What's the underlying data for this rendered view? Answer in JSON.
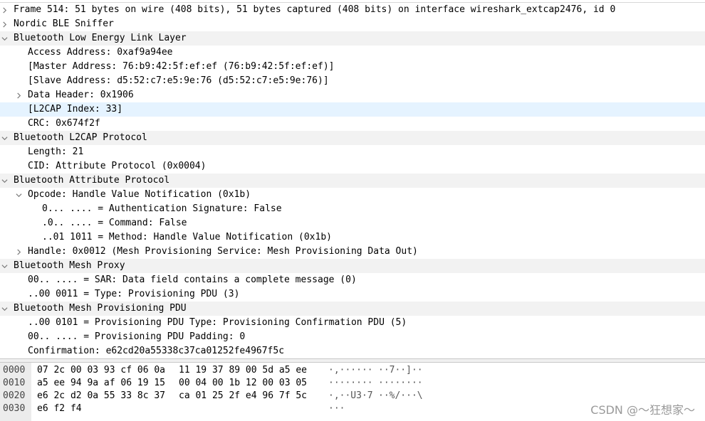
{
  "tree": [
    {
      "text": "Frame 514: 51 bytes on wire (408 bits), 51 bytes captured (408 bits) on interface wireshark_extcap2476, id 0",
      "expander": "collapsed",
      "level": 0,
      "style": "plain"
    },
    {
      "text": "Nordic BLE Sniffer",
      "expander": "collapsed",
      "level": 0,
      "style": "plain"
    },
    {
      "text": "Bluetooth Low Energy Link Layer",
      "expander": "expanded",
      "level": 0,
      "style": "shaded"
    },
    {
      "text": "Access Address: 0xaf9a94ee",
      "expander": "none",
      "level": 1,
      "style": "plain"
    },
    {
      "text": "[Master Address: 76:b9:42:5f:ef:ef (76:b9:42:5f:ef:ef)]",
      "expander": "none",
      "level": 1,
      "style": "plain"
    },
    {
      "text": "[Slave Address: d5:52:c7:e5:9e:76 (d5:52:c7:e5:9e:76)]",
      "expander": "none",
      "level": 1,
      "style": "plain"
    },
    {
      "text": "Data Header: 0x1906",
      "expander": "collapsed",
      "level": 1,
      "style": "plain"
    },
    {
      "text": "[L2CAP Index: 33]",
      "expander": "none",
      "level": 1,
      "style": "selected"
    },
    {
      "text": "CRC: 0x674f2f",
      "expander": "none",
      "level": 1,
      "style": "plain"
    },
    {
      "text": "Bluetooth L2CAP Protocol",
      "expander": "expanded",
      "level": 0,
      "style": "shaded"
    },
    {
      "text": "Length: 21",
      "expander": "none",
      "level": 1,
      "style": "plain"
    },
    {
      "text": "CID: Attribute Protocol (0x0004)",
      "expander": "none",
      "level": 1,
      "style": "plain"
    },
    {
      "text": "Bluetooth Attribute Protocol",
      "expander": "expanded",
      "level": 0,
      "style": "shaded"
    },
    {
      "text": "Opcode: Handle Value Notification (0x1b)",
      "expander": "expanded",
      "level": 1,
      "style": "plain"
    },
    {
      "text": "0... .... = Authentication Signature: False",
      "expander": "none",
      "level": 2,
      "style": "plain"
    },
    {
      "text": ".0.. .... = Command: False",
      "expander": "none",
      "level": 2,
      "style": "plain"
    },
    {
      "text": "..01 1011 = Method: Handle Value Notification (0x1b)",
      "expander": "none",
      "level": 2,
      "style": "plain"
    },
    {
      "text": "Handle: 0x0012 (Mesh Provisioning Service: Mesh Provisioning Data Out)",
      "expander": "collapsed",
      "level": 1,
      "style": "plain"
    },
    {
      "text": "Bluetooth Mesh Proxy",
      "expander": "expanded",
      "level": 0,
      "style": "shaded"
    },
    {
      "text": "00.. .... = SAR: Data field contains a complete message (0)",
      "expander": "none",
      "level": 1,
      "style": "plain"
    },
    {
      "text": "..00 0011 = Type: Provisioning PDU (3)",
      "expander": "none",
      "level": 1,
      "style": "plain"
    },
    {
      "text": "Bluetooth Mesh Provisioning PDU",
      "expander": "expanded",
      "level": 0,
      "style": "shaded"
    },
    {
      "text": "..00 0101 = Provisioning PDU Type: Provisioning Confirmation PDU (5)",
      "expander": "none",
      "level": 1,
      "style": "plain"
    },
    {
      "text": "00.. .... = Provisioning PDU Padding: 0",
      "expander": "none",
      "level": 1,
      "style": "plain"
    },
    {
      "text": "Confirmation: e62cd20a55338c37ca01252fe4967f5c",
      "expander": "none",
      "level": 1,
      "style": "plain"
    }
  ],
  "hexdump": [
    {
      "offset": "0000",
      "bytes1": "07 2c 00 03 93 cf 06 0a",
      "bytes2": "11 19 37 89 00 5d a5 ee",
      "ascii1": "·,······",
      "ascii2": "··7··]··"
    },
    {
      "offset": "0010",
      "bytes1": "a5 ee 94 9a af 06 19 15",
      "bytes2": "00 04 00 1b 12 00 03 05",
      "ascii1": "········",
      "ascii2": "········"
    },
    {
      "offset": "0020",
      "bytes1": "e6 2c d2 0a 55 33 8c 37",
      "bytes2": "ca 01 25 2f e4 96 7f 5c",
      "ascii1": "·,··U3·7",
      "ascii2": "··%/···\\"
    },
    {
      "offset": "0030",
      "bytes1": "e6 f2 f4",
      "bytes2": "",
      "ascii1": "···",
      "ascii2": ""
    }
  ],
  "watermark": "CSDN @～狂想家～",
  "colors": {
    "section_row_bg": "#f2f2f2",
    "selected_row_bg": "#e5f3ff",
    "hex_gutter_bg": "#ececec",
    "expander": "#7a7a7a"
  }
}
